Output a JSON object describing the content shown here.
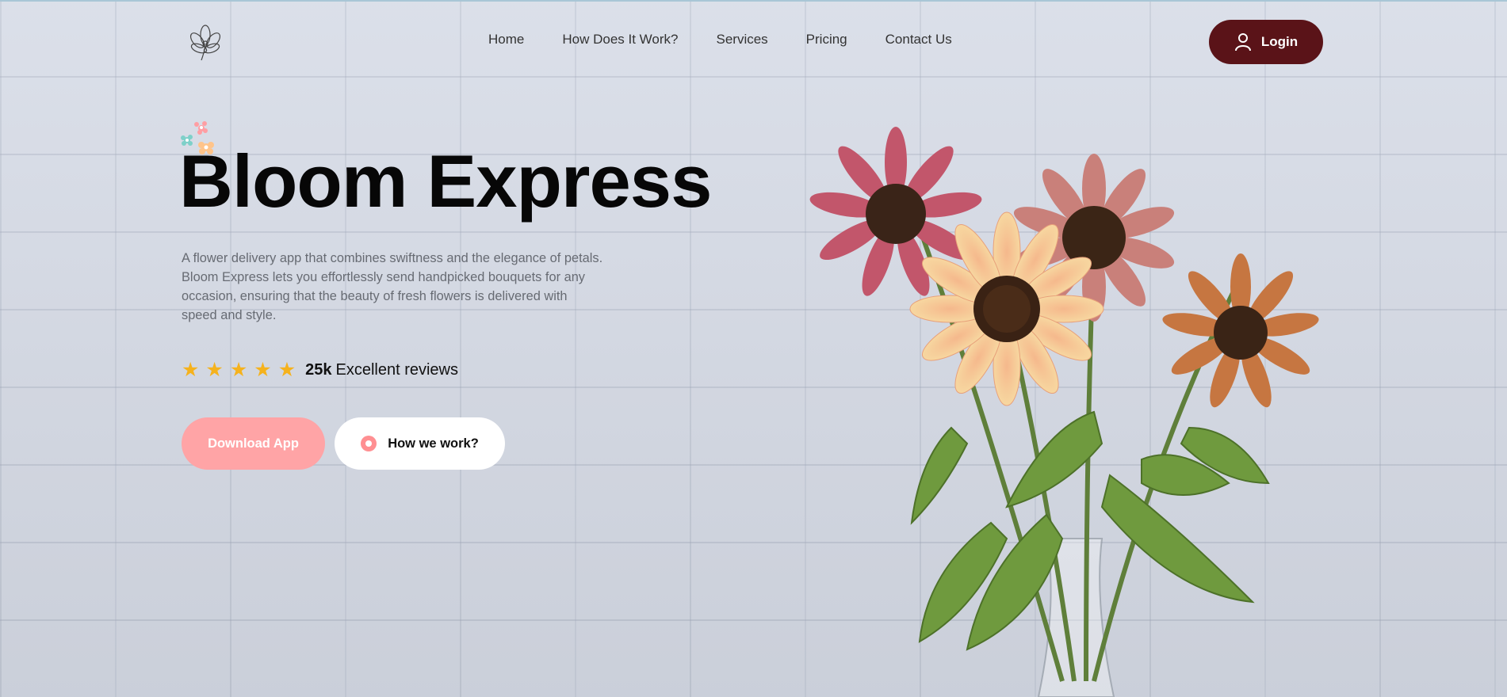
{
  "nav": {
    "items": [
      {
        "label": "Home"
      },
      {
        "label": "How Does It Work?"
      },
      {
        "label": "Services"
      },
      {
        "label": "Pricing"
      },
      {
        "label": "Contact Us"
      }
    ],
    "login_label": "Login"
  },
  "hero": {
    "title": "Bloom Express",
    "description": "A flower delivery app that combines swiftness and the elegance of petals. Bloom Express lets you effortlessly send handpicked bouquets for any occasion, ensuring that the beauty of fresh flowers is delivered with speed and style.",
    "rating": {
      "stars": 5,
      "count": "25k",
      "text": "Excellent reviews"
    },
    "buttons": {
      "download_label": "Download App",
      "how_label": "How we work?"
    }
  },
  "colors": {
    "login_bg": "#5a1318",
    "download_bg": "#ffa4a6",
    "star": "#f5b21d",
    "accent_dot": "#ff8f92"
  },
  "icons": {
    "logo": "flower-outline-logo",
    "login": "user-icon",
    "play": "play-circle-icon",
    "decoration": "flowers-decoration-icon"
  }
}
